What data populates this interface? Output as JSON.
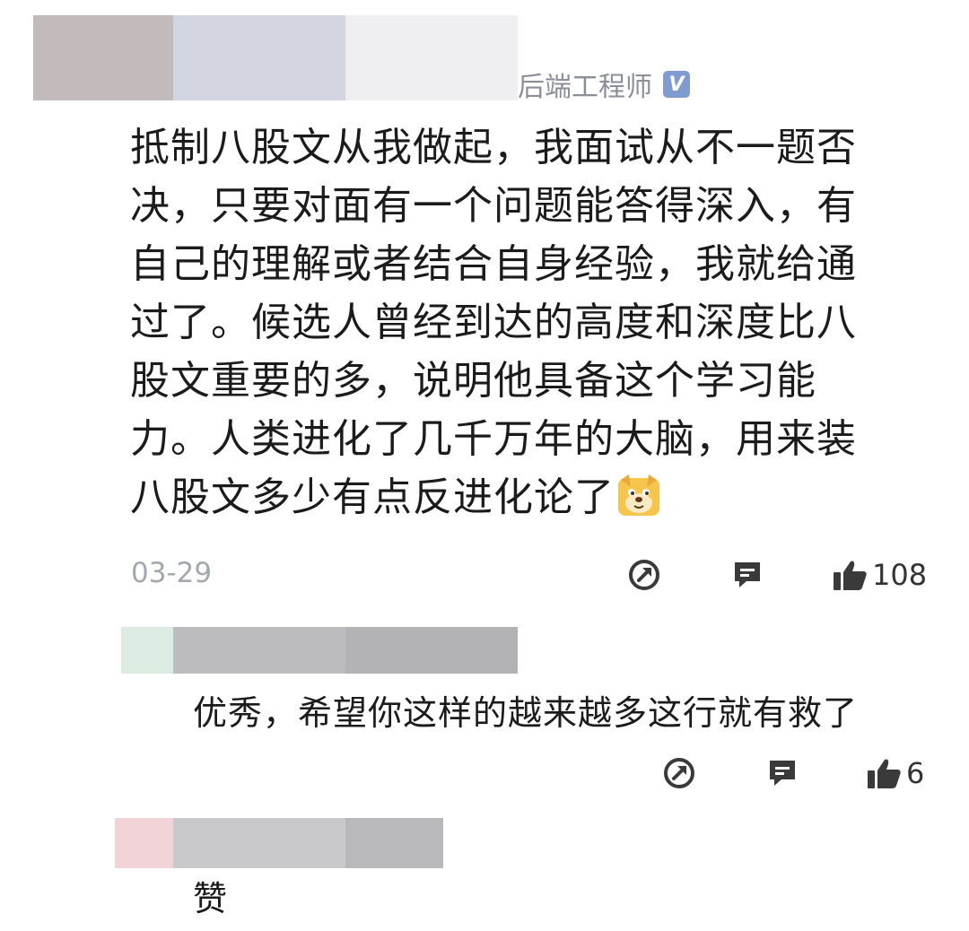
{
  "comment": {
    "author_title": "后端工程师",
    "verified_badge": "V",
    "text": "抵制八股文从我做起，我面试从不一题否决，只要对面有一个问题能答得深入，有自己的理解或者结合自身经验，我就给通过了。候选人曾经到达的高度和深度比八股文重要的多，说明他具备这个学习能力。人类进化了几千万年的大脑，用来装八股文多少有点反进化论了",
    "lines": [
      "抵制八股文从我做起，我面试从不一题否",
      "决，只要对面有一个问题能答得深入，有",
      "自己的理解或者结合自身经验，我就给通",
      "过了。候选人曾经到达的高度和深度比八",
      "股文重要的多，说明他具备这个学习能",
      "力。人类进化了几千万年的大脑，用来装",
      "八股文多少有点反进化论了"
    ],
    "emoji": "doge-emoji",
    "date": "03-29",
    "likes": "108"
  },
  "replies": [
    {
      "text": "优秀，希望你这样的越来越多这行就有救了",
      "likes": "6"
    },
    {
      "text": "赞"
    }
  ],
  "icons": {
    "share": "share-icon",
    "reply": "comment-icon",
    "like": "thumbs-up-icon"
  },
  "colors": {
    "meta_gray": "#a3a7ae",
    "badge_blue": "#7f9bd1",
    "icon_dark": "#3a3a3a"
  }
}
